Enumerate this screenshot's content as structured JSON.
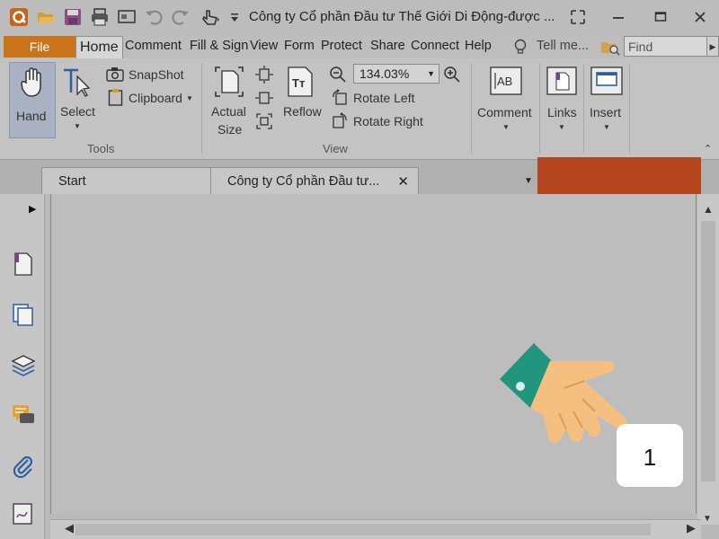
{
  "window": {
    "title": "Công ty Cổ phần Đầu tư Thế Giới Di Động-được ...",
    "controls": [
      "restore-view",
      "minimize",
      "maximize",
      "close"
    ]
  },
  "quick_access": [
    "app-logo-icon",
    "open-folder-icon",
    "save-icon",
    "print-icon",
    "screen-icon",
    "undo-icon",
    "redo-icon",
    "touch-mode-icon",
    "customize-arrow-icon"
  ],
  "menu": {
    "file_label": "File",
    "items": [
      "Home",
      "Comment",
      "Fill & Sign",
      "View",
      "Form",
      "Protect",
      "Share",
      "Connect",
      "Help"
    ],
    "active": "Home",
    "tell_me": "Tell me...",
    "find_placeholder": "Find"
  },
  "ribbon": {
    "tools": {
      "hand": "Hand",
      "select": "Select",
      "snapshot": "SnapShot",
      "clipboard": "Clipboard",
      "group_label": "Tools"
    },
    "view": {
      "actual_size_line1": "Actual",
      "actual_size_line2": "Size",
      "reflow": "Reflow",
      "zoom": "134.03%",
      "rotate_left": "Rotate Left",
      "rotate_right": "Rotate Right",
      "group_label": "View"
    },
    "comment": "Comment",
    "links": "Links",
    "insert": "Insert"
  },
  "tabs": {
    "start": "Start",
    "doc": "Công ty Cổ phần Đầu tư..."
  },
  "left_panel_icons": [
    "pages-icon",
    "copy-pages-icon",
    "layers-icon",
    "comments-icon",
    "attachment-icon",
    "signature-icon"
  ],
  "overlay": {
    "step_number": "1"
  },
  "colors": {
    "file_tab": "#c9731b",
    "hand_active": "#a8b2c2",
    "highlight_block": "#b4451f",
    "cuff": "#22957f",
    "skin": "#f5c07f"
  }
}
